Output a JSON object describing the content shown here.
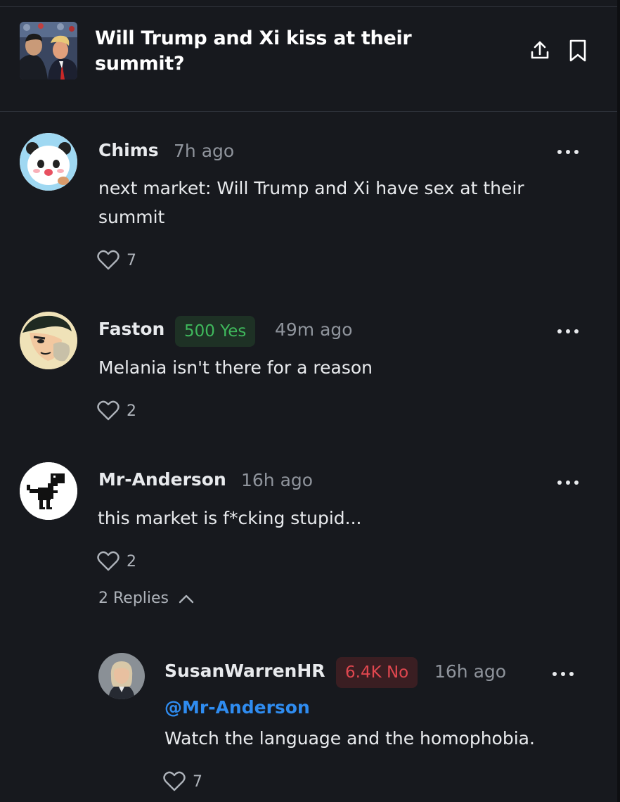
{
  "market": {
    "title": "Will Trump and Xi kiss at their summit?",
    "icons": {
      "share": "share-upload-icon",
      "bookmark": "bookmark-icon"
    }
  },
  "comments": [
    {
      "username": "Chims",
      "time": "7h ago",
      "text": "next market: Will Trump and Xi have sex at their summit",
      "likes": "7",
      "avatar": "panda-avatar"
    },
    {
      "username": "Faston",
      "position": "500 Yes",
      "time": "49m ago",
      "text": "Melania isn't there for a reason",
      "likes": "2",
      "avatar": "cartoon-man-avatar"
    },
    {
      "username": "Mr-Anderson",
      "time": "16h ago",
      "text": "this market is f*cking stupid...",
      "likes": "2",
      "avatar": "dino-avatar",
      "replies_label": "2 Replies"
    }
  ],
  "reply": {
    "username": "SusanWarrenHR",
    "position": "6.4K No",
    "time": "16h ago",
    "mention": "@Mr-Anderson",
    "text": "Watch the language and the homophobia.",
    "likes": "7",
    "avatar": "woman-portrait-avatar"
  },
  "colors": {
    "background": "#17191e",
    "yes": "#3fb95c",
    "no": "#e0474f",
    "mention": "#2f8cf0"
  }
}
